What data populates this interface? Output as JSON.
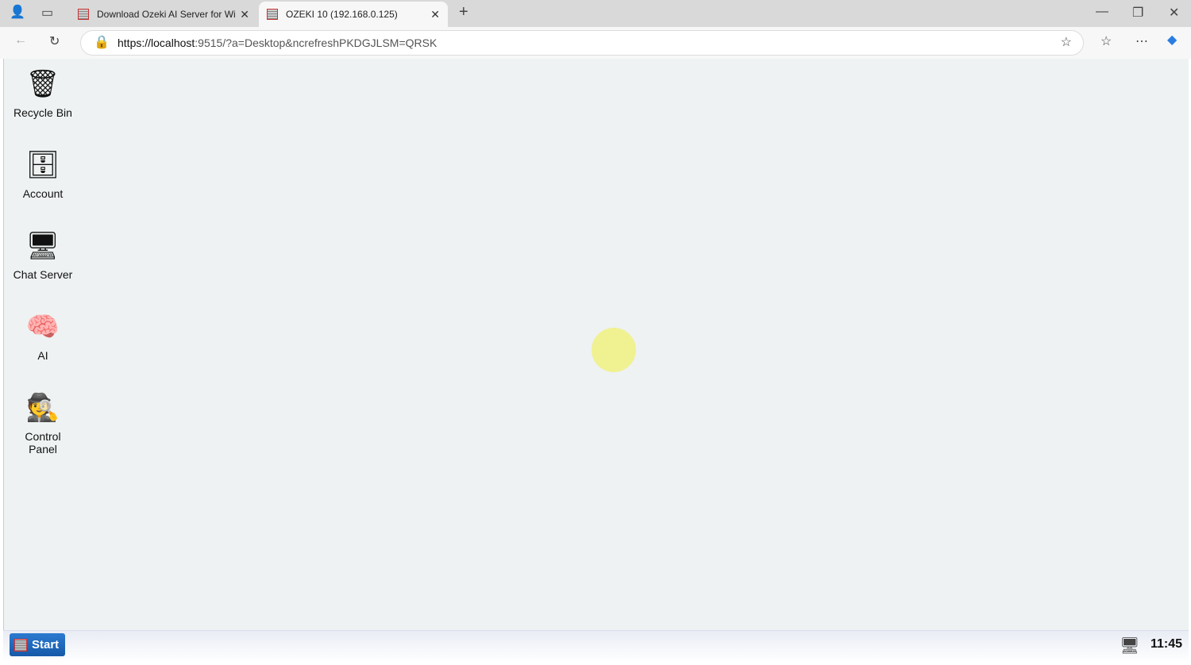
{
  "browser": {
    "tabs": [
      {
        "label": "Download Ozeki AI Server for Wi",
        "active": false
      },
      {
        "label": "OZEKI 10 (192.168.0.125)",
        "active": true
      }
    ],
    "url_host": "https://localhost",
    "url_rest": ":9515/?a=Desktop&ncrefreshPKDGJLSM=QRSK"
  },
  "desktop": {
    "icons": [
      {
        "label": "Recycle Bin",
        "icon": "recycle-bin-icon"
      },
      {
        "label": "Account",
        "icon": "account-icon"
      },
      {
        "label": "Chat Server",
        "icon": "chat-server-icon"
      },
      {
        "label": "AI",
        "icon": "ai-icon"
      },
      {
        "label": "Control Panel",
        "icon": "control-panel-icon"
      }
    ]
  },
  "taskbar": {
    "start_label": "Start",
    "clock": "11:45"
  }
}
